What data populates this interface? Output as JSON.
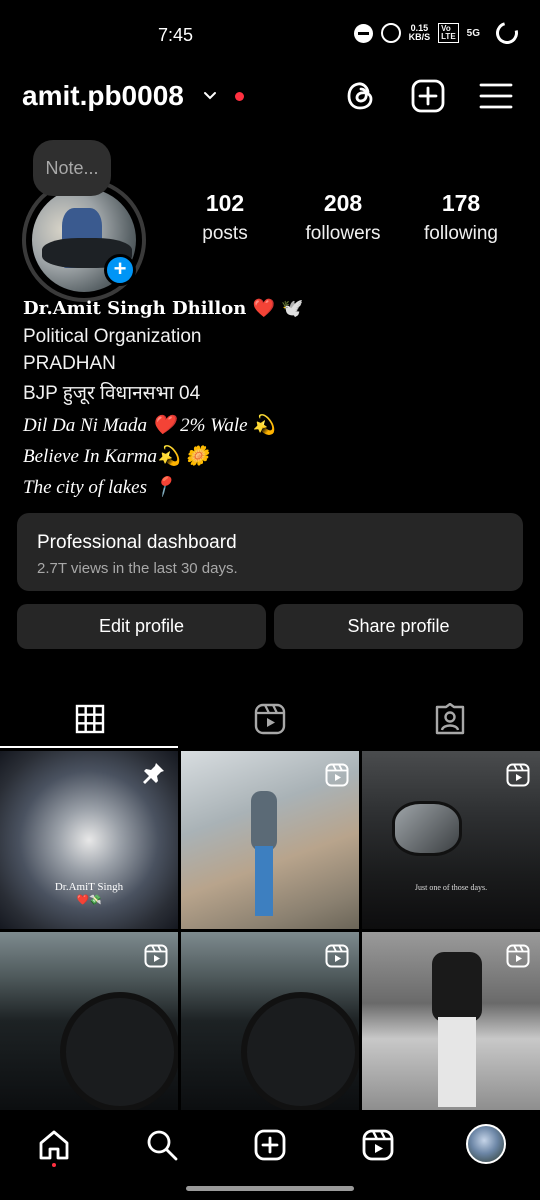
{
  "status_bar": {
    "time": "7:45",
    "net_speed_value": "0.15",
    "net_speed_unit": "KB/S",
    "volte_label": "Vo\nLTE",
    "signal_label": "5G"
  },
  "header": {
    "username": "amit.pb0008",
    "threads_icon": "threads-icon",
    "create_icon": "plus-square-icon",
    "menu_icon": "hamburger-menu-icon"
  },
  "profile": {
    "note_placeholder": "Note...",
    "stats": [
      {
        "value": "102",
        "label": "posts"
      },
      {
        "value": "208",
        "label": "followers"
      },
      {
        "value": "178",
        "label": "following"
      }
    ],
    "bio": {
      "name": "Dr.Amit Singh Dhillon  ❤️ 🕊️",
      "category": "Political Organization",
      "line1": "PRADHAN",
      "line2": "BJP हुजूर विधानसभा 04",
      "line3": "Dil Da Ni Mada ❤️  2% Wale 💫",
      "line4": " Believe In Karma💫  🌼",
      "line5": "The city of lakes 📍"
    }
  },
  "dashboard": {
    "title": "Professional dashboard",
    "subtitle": "2.7T views in the last 30 days."
  },
  "buttons": {
    "edit": "Edit profile",
    "share": "Share profile"
  },
  "tabs": [
    "grid-icon",
    "reels-icon",
    "tagged-icon"
  ],
  "grid": {
    "posts": [
      {
        "caption": "Dr.AmiT Singh",
        "caption2": "❤️💸",
        "badge": "pin-icon"
      },
      {
        "caption": "",
        "badge": "reel-icon"
      },
      {
        "caption": "Just one of those days.",
        "badge": "reel-icon"
      },
      {
        "caption": "",
        "badge": "reel-icon"
      },
      {
        "caption": "",
        "badge": "reel-icon"
      },
      {
        "caption": "",
        "badge": "reel-icon"
      }
    ]
  },
  "bottom_nav": [
    "home-icon",
    "search-icon",
    "create-icon",
    "reels-icon",
    "profile-avatar"
  ],
  "colors": {
    "background": "#000000",
    "surface": "#262626",
    "accent_blue": "#0095f6",
    "notification_red": "#ff3040"
  }
}
